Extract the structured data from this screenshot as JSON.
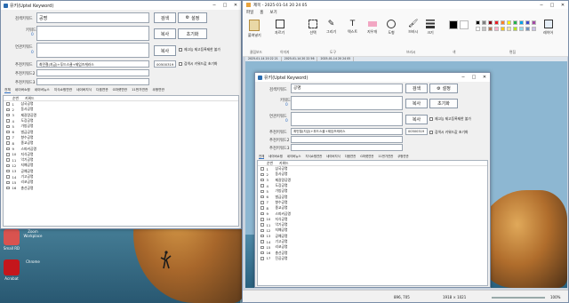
{
  "app": {
    "title": "유키(Uptel Keyword)",
    "search_label": "검색키워드",
    "search_value": "공명",
    "search_button": "검색",
    "settings_button": "설정",
    "keyword_label": "키워드",
    "keyword_count": "0",
    "copy_button": "복사",
    "reset_button": "초기화",
    "related_label": "연관키워드",
    "related_count": "0",
    "copy_button2": "복사",
    "check1": "제고능 제고등록제한 불가",
    "check2": "검색시 키워드값 초기화",
    "rec_label": "추천키워드",
    "rec_value": "최민철(지금)+푸드스쿨+제임즈캐러스",
    "rec_number": "00500319",
    "rec_label2": "추천키워드2",
    "rec_label3": "추천키워드3",
    "tabs": [
      "전체",
      "네이버쇼핑",
      "네이버뉴스",
      "지식쇼핑연관",
      "네이버지식",
      "다음연관",
      "G마켓연관",
      "11번가연관",
      "쿠팡연관"
    ],
    "list_headers": [
      "순번",
      "키워드"
    ],
    "rows": [
      {
        "n": "1",
        "k": "삼국공명"
      },
      {
        "n": "2",
        "k": "동사공명"
      },
      {
        "n": "3",
        "k": "제갈량공명"
      },
      {
        "n": "4",
        "k": "도장공명"
      },
      {
        "n": "5",
        "k": "가방공명"
      },
      {
        "n": "6",
        "k": "벌금공명"
      },
      {
        "n": "7",
        "k": "향수공명"
      },
      {
        "n": "8",
        "k": "종교공명"
      },
      {
        "n": "9",
        "k": "스피커공명"
      },
      {
        "n": "10",
        "k": "지식공명"
      },
      {
        "n": "11",
        "k": "악기공명"
      },
      {
        "n": "12",
        "k": "지폐공명"
      },
      {
        "n": "13",
        "k": "공예공명"
      },
      {
        "n": "14",
        "k": "기고공명"
      },
      {
        "n": "15",
        "k": "리코공명"
      },
      {
        "n": "16",
        "k": "총선공명"
      },
      {
        "n": "17",
        "k": "진공공명"
      }
    ]
  },
  "desktop": {
    "icons": [
      {
        "label": "Small RD",
        "color": "#d9534f"
      },
      {
        "label": "Zoom Workplace",
        "color": "#2d8cff"
      },
      {
        "label": "Acrobat",
        "color": "#c4161c"
      },
      {
        "label": "Chrome",
        "color": "#34a853"
      }
    ]
  },
  "paint": {
    "title": "제목 - 2025-01-14 20 24 05",
    "menu": [
      "파일",
      "홈",
      "보기"
    ],
    "groups": [
      "클립보드",
      "이미지",
      "도구",
      "브러시",
      "도형",
      "크기",
      "색",
      "편집",
      "레이어"
    ],
    "tools": [
      "붙여넣기",
      "자르기",
      "선택",
      "그리기",
      "텍스트",
      "지우개",
      "도형",
      "브러시",
      "크기"
    ],
    "inner_tabs": [
      "2025-01-14 20 22 21",
      "2025-01-14 20 22 56",
      "2025-01-14 20 24 05"
    ],
    "status_left": "896, 705",
    "status_mid": "1918 × 1021",
    "zoom": "100%",
    "palette": [
      "#000000",
      "#7f7f7f",
      "#880015",
      "#ed1c24",
      "#ff7f27",
      "#fff200",
      "#22b14c",
      "#00a2e8",
      "#3f48cc",
      "#a349a4",
      "#ffffff",
      "#c3c3c3",
      "#b97a57",
      "#ffaec9",
      "#ffc90e",
      "#efe4b0",
      "#b5e61d",
      "#99d9ea",
      "#7092be",
      "#c8bfe7"
    ]
  }
}
